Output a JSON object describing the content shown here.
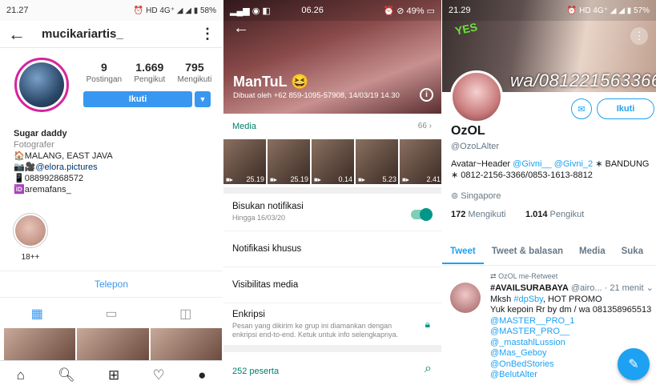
{
  "instagram": {
    "status_time": "21.27",
    "status_right": "⏰ HD 4G⁺ ◢ ◢ ▮ 58%",
    "username": "mucikariartis_",
    "stats": [
      {
        "value": "9",
        "label": "Postingan"
      },
      {
        "value": "1.669",
        "label": "Pengikut"
      },
      {
        "value": "795",
        "label": "Mengikuti"
      }
    ],
    "follow_label": "Ikuti",
    "bio": {
      "name": "Sugar daddy",
      "category": "Fotografer",
      "lines": [
        "🏠MALANG, EAST JAVA",
        "📷🎥@elora.pictures",
        "📱088992868572",
        "🆔aremafans_"
      ]
    },
    "highlight_label": "18++",
    "phone_button": "Telepon"
  },
  "whatsapp": {
    "status_time": "06.26",
    "status_right": "⏰ ⊘ 49% ▭",
    "group_name": "ManTuL 😆",
    "group_desc": "Dibuat oleh +62 859-1095-57908, 14/03/19 14.30",
    "media_label": "Media",
    "media_count": "66 ›",
    "thumbs": [
      "25.19",
      "25.19",
      "0.14",
      "5.23",
      "2.41"
    ],
    "mute_title": "Bisukan notifikasi",
    "mute_sub": "Hingga 16/03/20",
    "custom_notif": "Notifikasi khusus",
    "media_visibility": "Visibilitas media",
    "encryption_title": "Enkripsi",
    "encryption_sub": "Pesan yang dikirim ke grup ini diamankan dengan enkripsi end-to-end. Ketuk untuk info selengkapnya.",
    "participants": "252 peserta"
  },
  "twitter": {
    "status_time": "21.29",
    "status_right": "⏰ HD 4G⁺ ◢ ◢ ▮ 57%",
    "banner_text": "wa/081221563366",
    "banner_badge": "YES",
    "follow_label": "Ikuti",
    "name": "OzOL",
    "handle": "@OzoLAlter",
    "bio_pre": "Avatar~Header ",
    "bio_m1": "@Givni__",
    "bio_m2": "@Givni_2",
    "bio_post": " ∗ BANDUNG ∗ 0812-2156-3366/0853-1613-8812",
    "location": "Singapore",
    "following_count": "172",
    "following_label": "Mengikuti",
    "followers_count": "1.014",
    "followers_label": "Pengikut",
    "tabs": [
      "Tweet",
      "Tweet & balasan",
      "Media",
      "Suka"
    ],
    "retweet_label": "OzOL me-Retweet",
    "tweet_author": "#AVAILSURABAYA",
    "tweet_meta": "@airo... · 21 menit",
    "tweet_line1_pre": "Mksh ",
    "tweet_line1_tag": "#dpSby",
    "tweet_line1_post": ", HOT PROMO",
    "tweet_line2": "Yuk kepoin Rr by dm / wa 081358965513",
    "tweet_mentions": [
      "@MASTER__PRO_1",
      "@MASTER_PRO__",
      "@_mastahlLussion",
      "@Mas_Geboy",
      "@OnBedStories",
      "@BelutAlter"
    ]
  }
}
